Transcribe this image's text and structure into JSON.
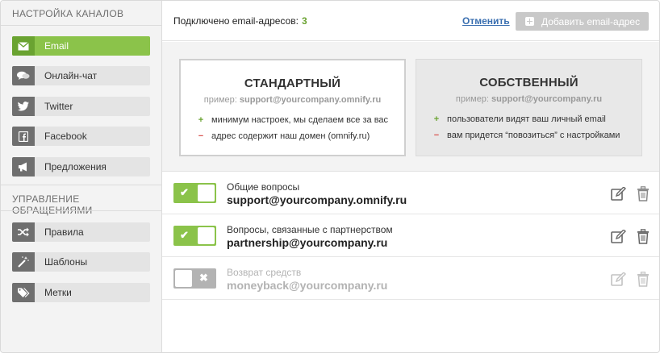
{
  "sidebar": {
    "channels_title": "НАСТРОЙКА КАНАЛОВ",
    "channels": [
      {
        "label": "Email",
        "icon": "envelope-icon",
        "active": true
      },
      {
        "label": "Онлайн-чат",
        "icon": "chat-bubbles-icon",
        "active": false
      },
      {
        "label": "Twitter",
        "icon": "twitter-bird-icon",
        "active": false
      },
      {
        "label": "Facebook",
        "icon": "facebook-icon",
        "active": false
      },
      {
        "label": "Предложения",
        "icon": "megaphone-icon",
        "active": false
      }
    ],
    "handling_title": "УПРАВЛЕНИЕ ОБРАЩЕНИЯМИ",
    "handling": [
      {
        "label": "Правила",
        "icon": "shuffle-icon"
      },
      {
        "label": "Шаблоны",
        "icon": "magic-wand-icon"
      },
      {
        "label": "Метки",
        "icon": "tags-icon"
      }
    ]
  },
  "header": {
    "connected_label": "Подключено email-адресов:",
    "connected_count": "3",
    "cancel_label": "Отменить",
    "add_label": "Добавить email-адрес"
  },
  "options": {
    "standard": {
      "title": "СТАНДАРТНЫЙ",
      "example_prefix": "пример:",
      "example_value": "support@yourcompany.omnify.ru",
      "plus": "минимум настроек, мы сделаем все за вас",
      "minus": "адрес содержит наш домен (omnify.ru)"
    },
    "custom": {
      "title": "СОБСТВЕННЫЙ",
      "example_prefix": "пример:",
      "example_value": "support@yourcompany.ru",
      "plus": "пользователи видят ваш личный email",
      "minus": "вам придется “повозиться” с настройками"
    }
  },
  "emails": [
    {
      "name": "Общие вопросы",
      "address": "support@yourcompany.omnify.ru",
      "enabled": true
    },
    {
      "name": "Вопросы, связанные с партнерством",
      "address": "partnership@yourcompany.ru",
      "enabled": true
    },
    {
      "name": "Возврат средств",
      "address": "moneyback@yourcompany.ru",
      "enabled": false
    }
  ],
  "colors": {
    "accent_green": "#8bc34a",
    "link_blue": "#3a6fb0",
    "minus_red": "#d9534f",
    "disabled_gray": "#b3b3b3"
  }
}
